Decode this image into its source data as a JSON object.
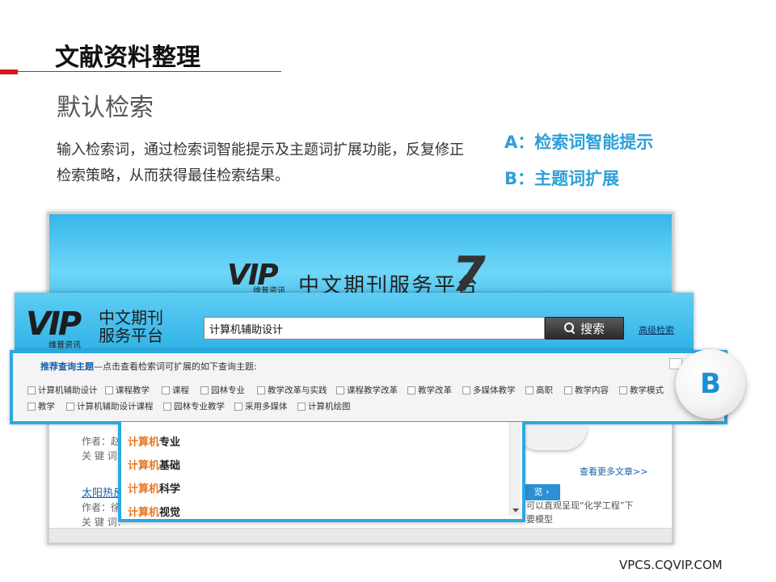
{
  "slide": {
    "title": "文献资料整理",
    "subtitle": "默认检索",
    "description": "输入检索词，通过检索词智能提示及主题词扩展功能，反复修正检索策略，从而获得最佳检索结果。",
    "feature_a": "A：检索词智能提示",
    "feature_b": "B：主题词扩展",
    "footer_url": "VPCS.CQVIP.COM",
    "accent_color": "#2ba0d8",
    "brand_red": "#d9141c"
  },
  "background_page": {
    "logo_mark": "VIP",
    "logo_sub": "维普资讯",
    "logo_text": "中文期刊服务平台",
    "logo_version": "7",
    "rows": {
      "author_1": "作者：赵",
      "keyword_1": "关 键 词：",
      "link_2": "太阳热反",
      "author_2": "作者：徐",
      "keyword_2": "关 键 词：",
      "more_articles": "查看更多文章>>",
      "nav_button": "览 ›",
      "right_text_1": "可以直观呈现“化学工程”下",
      "right_text_2": "要模型"
    }
  },
  "header": {
    "logo_mark": "VIP",
    "logo_sub": "维普资讯",
    "logo_text": "中文期刊服务平台",
    "search_value": "计算机辅助设计",
    "search_button_label": "搜索",
    "advanced_search_label": "高级检索"
  },
  "topic_panel": {
    "head_strong": "推荐查询主题",
    "head_rest": "—点击查看检索词可扩展的如下查询主题:",
    "badge": "B",
    "items": [
      "计算机辅助设计",
      "课程教学",
      "课程",
      "园林专业",
      "教学改革与实践",
      "课程教学改革",
      "教学改革",
      "多媒体教学",
      "高职",
      "教学内容",
      "教学模式",
      "教学",
      "计算机辅助设计课程",
      "园林专业教学",
      "采用多媒体",
      "计算机绘图"
    ]
  },
  "suggestions": {
    "highlight": "计算机",
    "items": [
      {
        "hl": "计算机",
        "rest": "专业"
      },
      {
        "hl": "计算机",
        "rest": "基础"
      },
      {
        "hl": "计算机",
        "rest": "科学"
      },
      {
        "hl": "计算机",
        "rest": "视觉"
      }
    ]
  }
}
